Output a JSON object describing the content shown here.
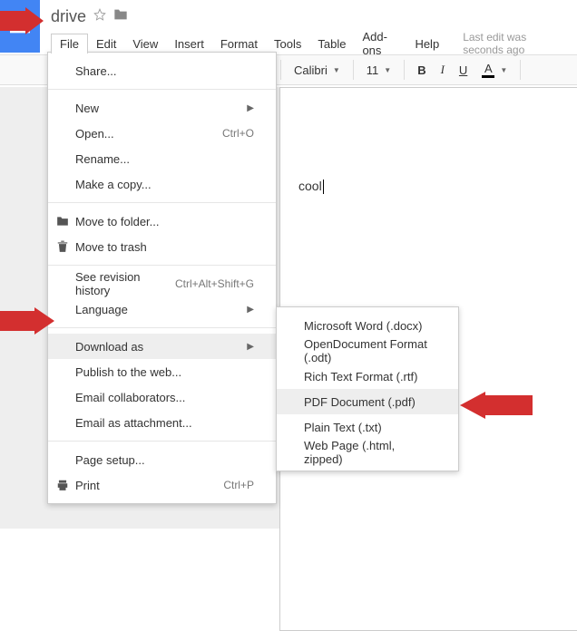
{
  "doc": {
    "title": "drive"
  },
  "menubar": {
    "file": "File",
    "edit": "Edit",
    "view": "View",
    "insert": "Insert",
    "format": "Format",
    "tools": "Tools",
    "table": "Table",
    "addons": "Add-ons",
    "help": "Help",
    "last_edit": "Last edit was seconds ago"
  },
  "toolbar": {
    "font": "Calibri",
    "size": "11",
    "bold": "B",
    "italic": "I",
    "underline": "U",
    "textcolor": "A"
  },
  "page": {
    "text": "cool"
  },
  "file_menu": {
    "share": "Share...",
    "new": "New",
    "open": "Open...",
    "open_sc": "Ctrl+O",
    "rename": "Rename...",
    "make_copy": "Make a copy...",
    "move_to_folder": "Move to folder...",
    "move_to_trash": "Move to trash",
    "revision": "See revision history",
    "revision_sc": "Ctrl+Alt+Shift+G",
    "language": "Language",
    "download_as": "Download as",
    "publish": "Publish to the web...",
    "email_collab": "Email collaborators...",
    "email_attach": "Email as attachment...",
    "page_setup": "Page setup...",
    "print": "Print",
    "print_sc": "Ctrl+P"
  },
  "submenu": {
    "docx": "Microsoft Word (.docx)",
    "odt": "OpenDocument Format (.odt)",
    "rtf": "Rich Text Format (.rtf)",
    "pdf": "PDF Document (.pdf)",
    "txt": "Plain Text (.txt)",
    "html": "Web Page (.html, zipped)"
  }
}
